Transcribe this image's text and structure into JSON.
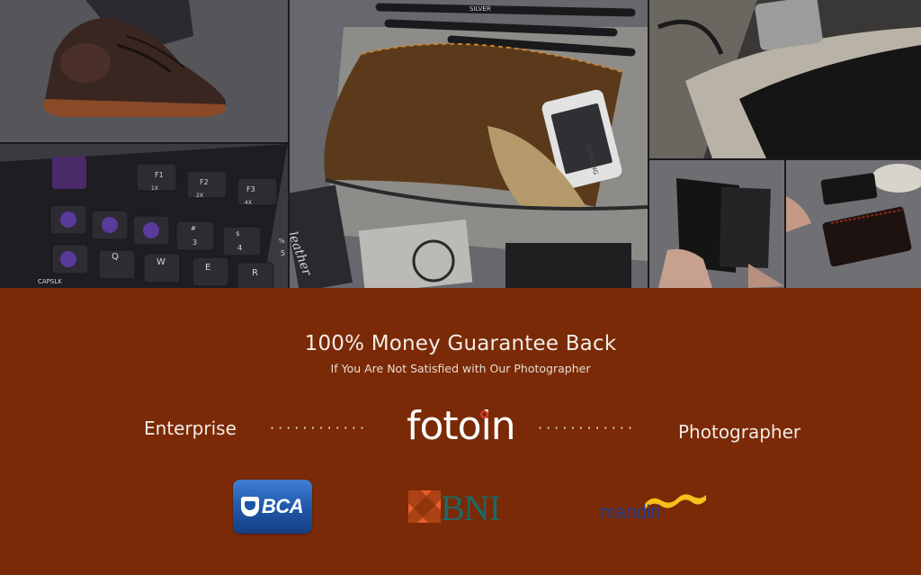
{
  "headline": "100% Money Guarantee Back",
  "subline": "If You Are Not Satisfied with Our Photographer",
  "flow": {
    "left_label": "Enterprise",
    "right_label": "Photographer",
    "left_dots": "············",
    "right_dots": "············"
  },
  "brand": {
    "name": "fotoin"
  },
  "banks": {
    "bca": "BCA",
    "bni": "BNI",
    "mandiri": "mandiri"
  },
  "keyboard": {
    "fn_keys": [
      "F1",
      "F2",
      "F3"
    ],
    "fn_sublabels": [
      "1X",
      "2X",
      "4X"
    ],
    "num_keys": [
      "#",
      "$",
      "%"
    ],
    "num_sublabels": [
      "3",
      "4",
      "5"
    ],
    "letter_keys": [
      "Q",
      "W",
      "E",
      "R"
    ],
    "caps_label": "CAPSLK"
  },
  "photo_text": {
    "pen_label": "SILVER",
    "phone_brand": "SAMSUNG",
    "card_lettering": "leather"
  },
  "colors": {
    "panel_bg": "#7a2a06",
    "text": "#f3ece6",
    "fotoin_accent": "#e03a2a",
    "bca_blue": "#1f56a8",
    "bni_orange": "#e8602a",
    "bni_teal": "#1a6a68",
    "mandiri_blue": "#233f96",
    "mandiri_gold": "#f6c21a"
  }
}
